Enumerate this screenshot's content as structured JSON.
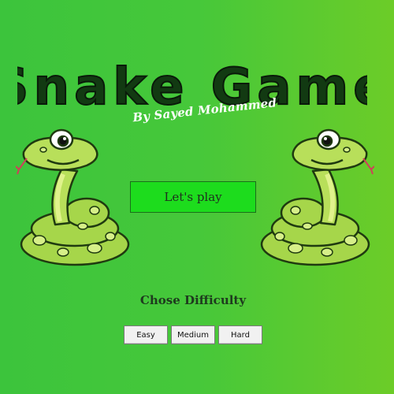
{
  "title": "Snake Game",
  "byline": "By Sayed Mohammed",
  "play_button": "Let's play",
  "difficulty": {
    "heading": "Chose Difficulty",
    "options": [
      "Easy",
      "Medium",
      "Hard"
    ]
  },
  "colors": {
    "background_left": "#3cc43c",
    "background_right": "#6ccc28",
    "play_button": "#1ddc1d",
    "title": "#123a12",
    "snake_body": "#a6d64a",
    "snake_belly": "#e0f28c"
  },
  "icons": {
    "left_snake": "snake-icon",
    "right_snake": "snake-icon"
  }
}
